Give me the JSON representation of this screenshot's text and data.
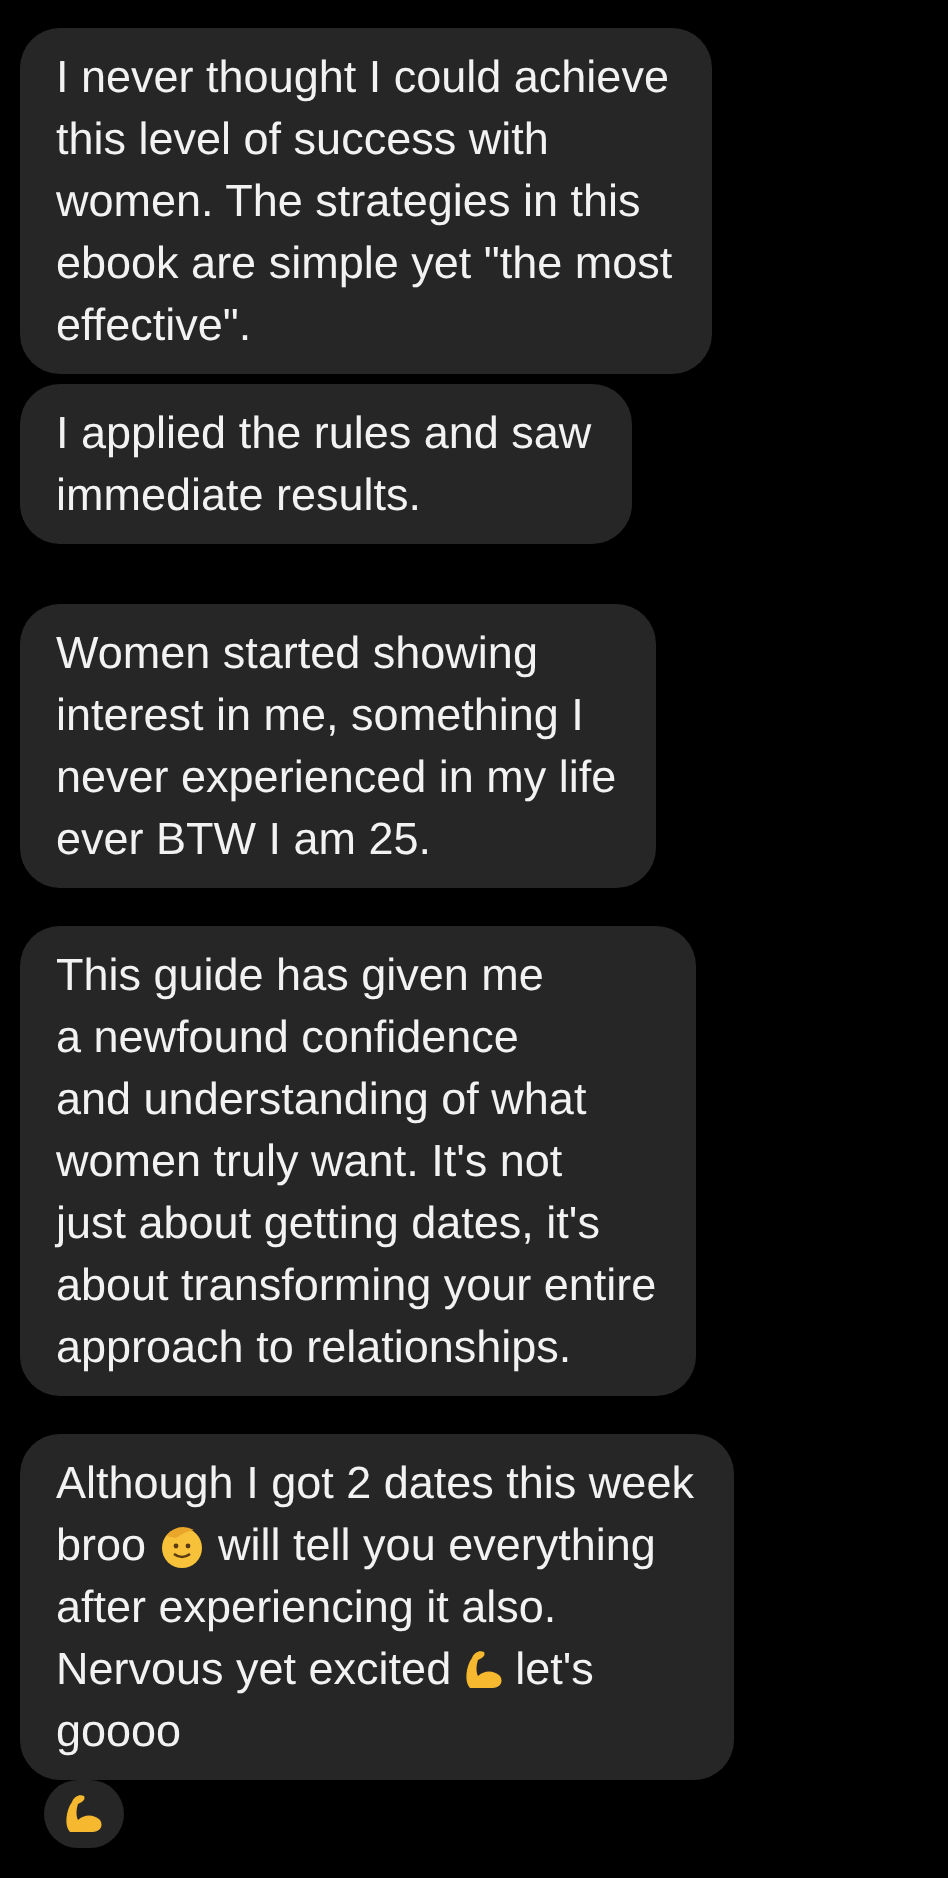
{
  "messages": [
    {
      "kind": "plain",
      "text": "I never thought I could achieve\nthis level of success with\nwomen. The strategies in this\nebook are simple yet \"the most\neffective\"."
    },
    {
      "kind": "plain",
      "text": "I applied the rules and saw\nimmediate results."
    },
    {
      "kind": "plain",
      "text": "Women started showing\ninterest in me, something I\nnever experienced in my life\never BTW I am 25."
    },
    {
      "kind": "plain",
      "text": "This guide has given me\na newfound confidence\nand understanding of what\nwomen truly want. It's not\njust about getting dates, it's\nabout transforming your entire\napproach to relationships."
    },
    {
      "kind": "mixed",
      "lines": [
        [
          {
            "kind": "text",
            "text": "Although I got 2 dates this week"
          }
        ],
        [
          {
            "kind": "text",
            "text": "broo"
          },
          {
            "kind": "smiley"
          },
          {
            "kind": "text",
            "text": "will tell you everything"
          }
        ],
        [
          {
            "kind": "text",
            "text": "after experiencing it also."
          }
        ],
        [
          {
            "kind": "text",
            "text": "Nervous yet excited"
          },
          {
            "kind": "arm"
          },
          {
            "kind": "text",
            "text": "let's"
          }
        ],
        [
          {
            "kind": "text",
            "text": "goooo"
          }
        ]
      ]
    }
  ],
  "reaction": {
    "kind": "arm"
  }
}
